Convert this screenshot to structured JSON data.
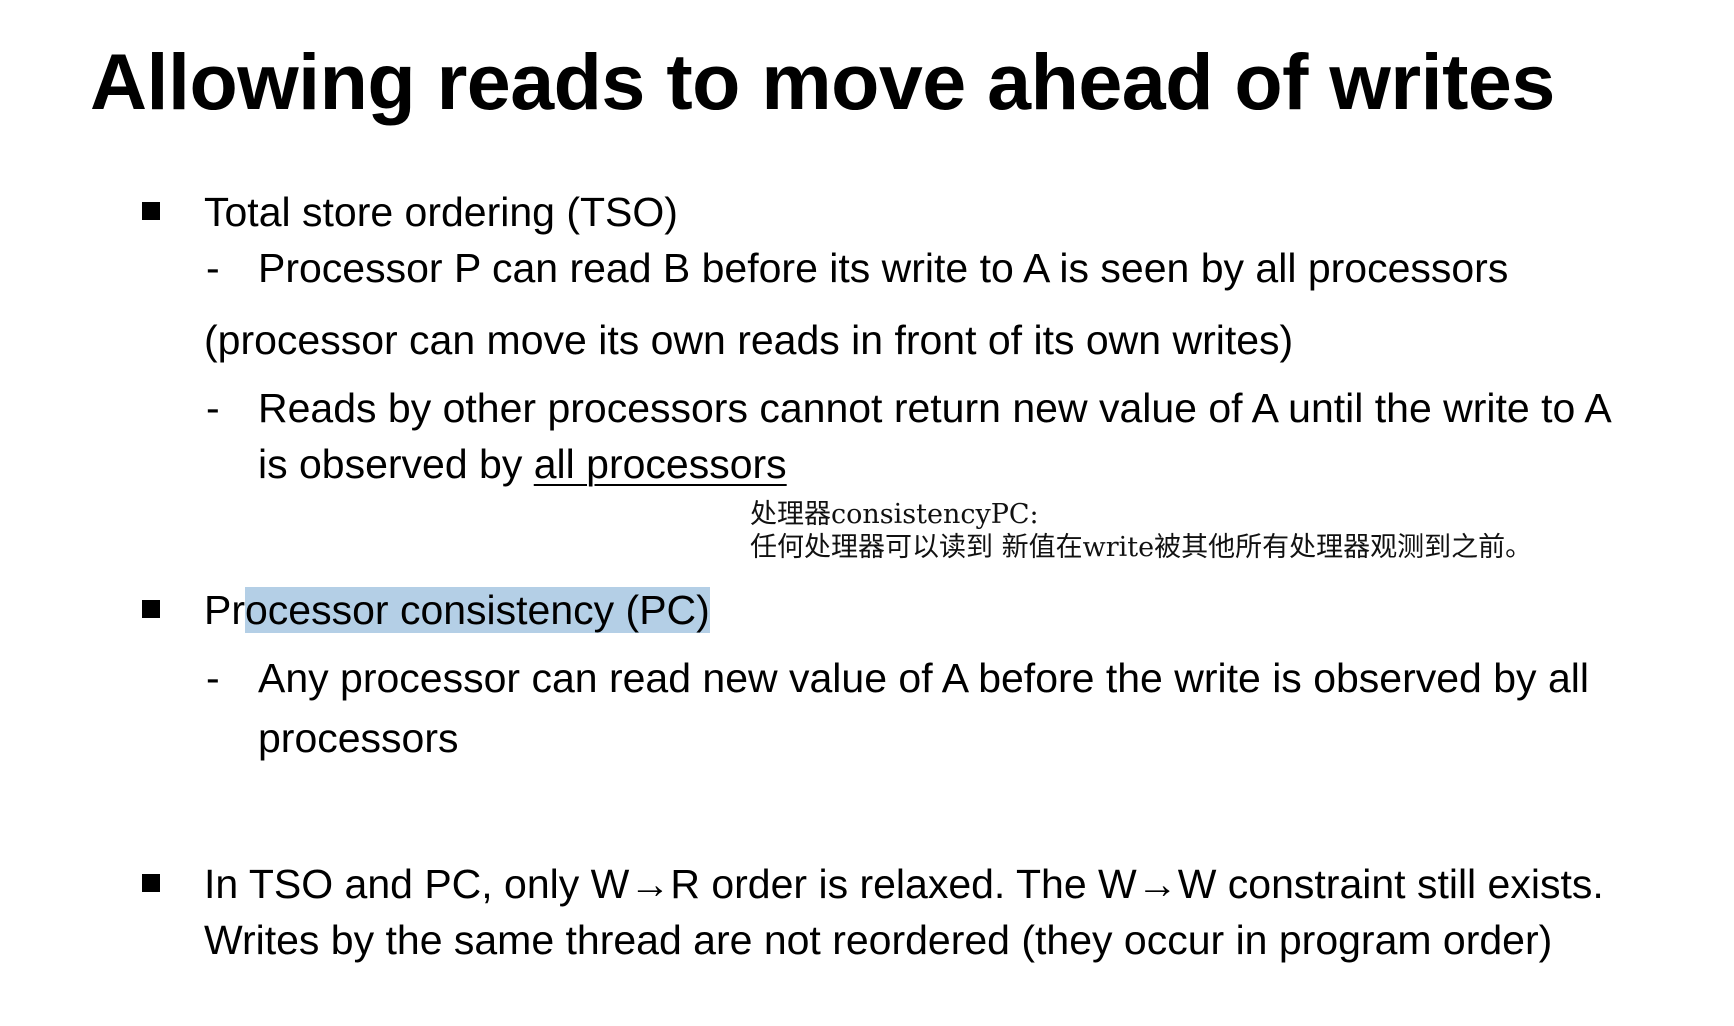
{
  "slide": {
    "title": "Allowing reads to move ahead of writes",
    "tso": {
      "heading": "Total store ordering (TSO)",
      "dash1": "Processor P can read B before its write to A is seen by all processors",
      "paren": "(processor can move its own reads in front of its own writes)",
      "dash2_line1": "Reads by other processors cannot return new value of A until the write to A",
      "dash2_line2_prefix": "is observed by ",
      "dash2_line2_underlined": "all processors"
    },
    "note": {
      "line1": "处理器consistencyPC:",
      "line2": "任何处理器可以读到 新值在write被其他所有处理器观测到之前。"
    },
    "pc": {
      "heading_prefix": "Pr",
      "heading_highlighted": "ocessor consistency (PC)",
      "dash1_line1": "Any processor can read new value of A before the write is observed by all",
      "dash1_line2": "processors"
    },
    "summary": {
      "line1": "In TSO and PC, only W→R order is relaxed. The W→W constraint still exists.",
      "line2": "Writes by the same thread are not reordered (they occur in program order)"
    },
    "dash_glyph": "-",
    "highlight_color": "#b4cfe6"
  }
}
